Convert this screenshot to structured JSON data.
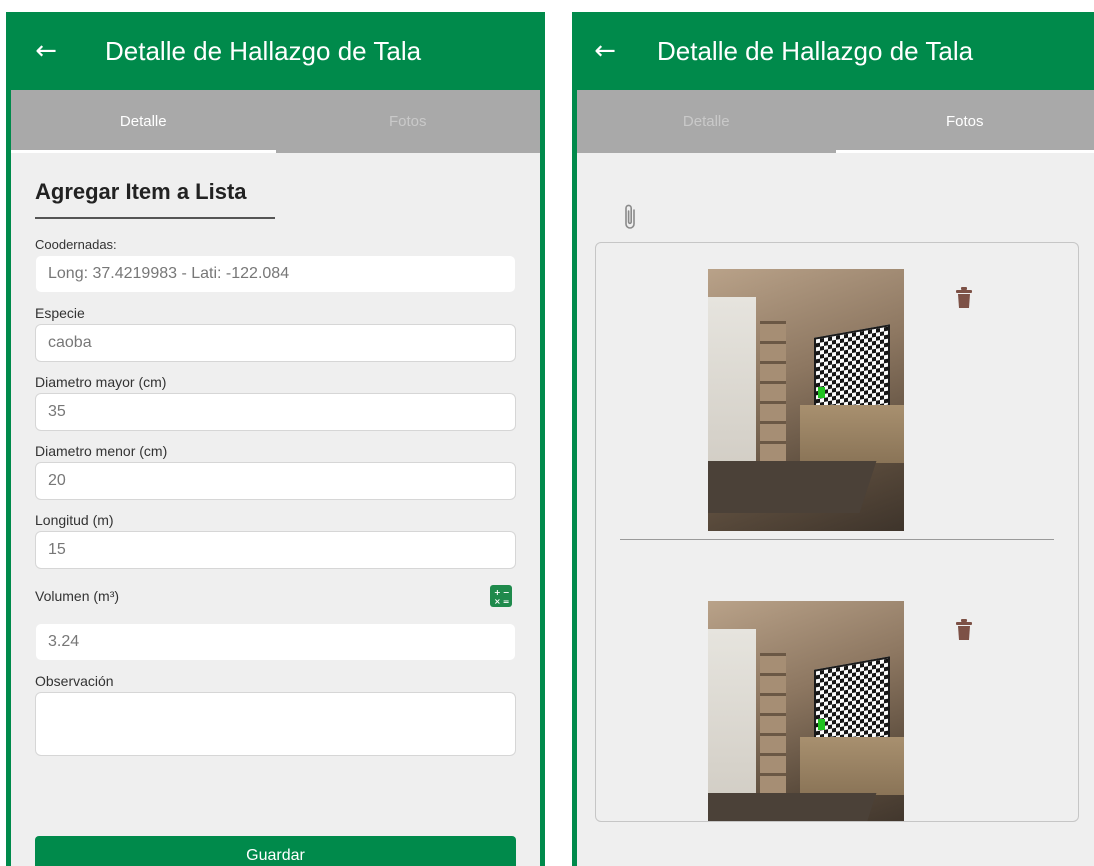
{
  "colors": {
    "primary": "#008a4b",
    "tab_bar": "#a9a9a9",
    "screen_bg": "#efefef",
    "delete": "#7d5146"
  },
  "icons": {
    "back": "arrow-left-icon",
    "calculator": "calculator-icon",
    "attach": "paperclip-icon",
    "delete": "trash-icon"
  },
  "detail_screen": {
    "appbar": {
      "back_glyph": "←",
      "title": "Detalle de Hallazgo de Tala"
    },
    "tabs": [
      {
        "label": "Detalle",
        "active": true
      },
      {
        "label": "Fotos",
        "active": false
      }
    ],
    "form": {
      "section_title": "Agregar Item a Lista",
      "coords": {
        "label": "Coodernadas:",
        "value": "Long: 37.4219983 - Lati: -122.084"
      },
      "species": {
        "label": "Especie",
        "value": "caoba"
      },
      "diam_major": {
        "label": "Diametro mayor (cm)",
        "value": "35"
      },
      "diam_minor": {
        "label": "Diametro menor (cm)",
        "value": "20"
      },
      "length": {
        "label": "Longitud (m)",
        "value": "15"
      },
      "volume": {
        "label": "Volumen (m³)",
        "value": "3.24"
      },
      "observation": {
        "label": "Observación",
        "value": ""
      },
      "save_label": "Guardar"
    }
  },
  "photos_screen": {
    "appbar": {
      "back_glyph": "←",
      "title": "Detalle de Hallazgo de Tala"
    },
    "tabs": [
      {
        "label": "Detalle",
        "active": false
      },
      {
        "label": "Fotos",
        "active": true
      }
    ],
    "photo_count": 2
  }
}
